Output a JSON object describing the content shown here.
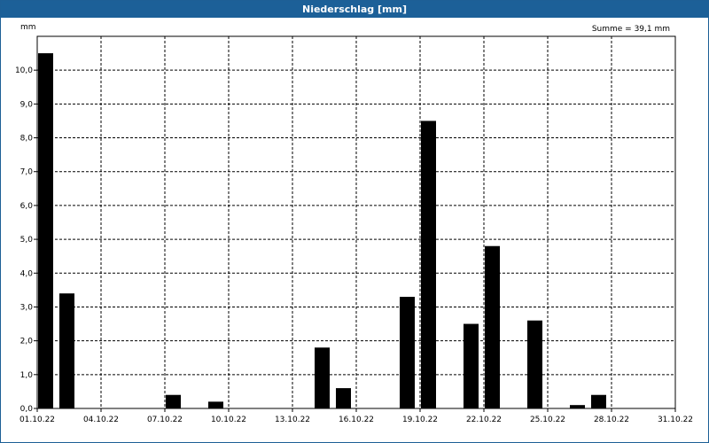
{
  "window": {
    "title": "Niederschlag [mm]"
  },
  "chart_data": {
    "type": "bar",
    "title": "Niederschlag [mm]",
    "ylabel": "mm",
    "summary": "Summe = 39,1 mm",
    "ylim": [
      0,
      11
    ],
    "y_ticks": [
      "0,0",
      "1,0",
      "2,0",
      "3,0",
      "4,0",
      "5,0",
      "6,0",
      "7,0",
      "8,0",
      "9,0",
      "10,0"
    ],
    "x_ticks": [
      "01.10.22",
      "04.10.22",
      "07.10.22",
      "10.10.22",
      "13.10.22",
      "16.10.22",
      "19.10.22",
      "22.10.22",
      "25.10.22",
      "28.10.22",
      "31.10.22"
    ],
    "grid": true,
    "legend": "none",
    "bar_color": "#000000",
    "categories": [
      "01.10.22",
      "02.10.22",
      "03.10.22",
      "04.10.22",
      "05.10.22",
      "06.10.22",
      "07.10.22",
      "08.10.22",
      "09.10.22",
      "10.10.22",
      "11.10.22",
      "12.10.22",
      "13.10.22",
      "14.10.22",
      "15.10.22",
      "16.10.22",
      "17.10.22",
      "18.10.22",
      "19.10.22",
      "20.10.22",
      "21.10.22",
      "22.10.22",
      "23.10.22",
      "24.10.22",
      "25.10.22",
      "26.10.22",
      "27.10.22",
      "28.10.22",
      "29.10.22",
      "30.10.22",
      "31.10.22"
    ],
    "values": [
      10.5,
      3.4,
      0,
      0,
      0,
      0,
      0.4,
      0,
      0.2,
      0,
      0,
      0,
      0,
      1.8,
      0.6,
      0,
      0,
      3.3,
      8.5,
      0,
      2.5,
      4.8,
      0,
      2.6,
      0,
      0.1,
      0.4,
      0,
      0,
      0,
      0
    ]
  }
}
